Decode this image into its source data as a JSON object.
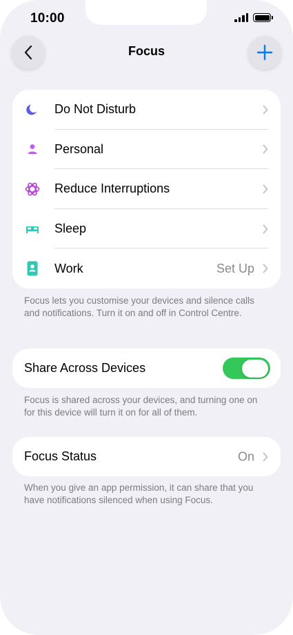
{
  "status_bar": {
    "time": "10:00"
  },
  "nav": {
    "title": "Focus",
    "back_icon": "chevron-left-icon",
    "add_icon": "plus-icon"
  },
  "focus_modes": [
    {
      "label": "Do Not Disturb",
      "detail": "",
      "icon": "moon-icon",
      "color": "#5e5ce6"
    },
    {
      "label": "Personal",
      "detail": "",
      "icon": "person-icon",
      "color": "#bf5af2"
    },
    {
      "label": "Reduce Interruptions",
      "detail": "",
      "icon": "atom-icon",
      "color": "#b93fd6"
    },
    {
      "label": "Sleep",
      "detail": "",
      "icon": "bed-icon",
      "color": "#30c7b5"
    },
    {
      "label": "Work",
      "detail": "Set Up",
      "icon": "id-badge-icon",
      "color": "#30c7b5"
    }
  ],
  "focus_note": "Focus lets you customise your devices and silence calls and notifications. Turn it on and off in Control Centre.",
  "share": {
    "label": "Share Across Devices",
    "enabled": true,
    "note": "Focus is shared across your devices, and turning one on for this device will turn it on for all of them."
  },
  "status": {
    "label": "Focus Status",
    "detail": "On",
    "note": "When you give an app permission, it can share that you have notifications silenced when using Focus."
  },
  "colors": {
    "accent": "#007aff",
    "toggle_on": "#34c759",
    "background": "#f1f0f6"
  }
}
